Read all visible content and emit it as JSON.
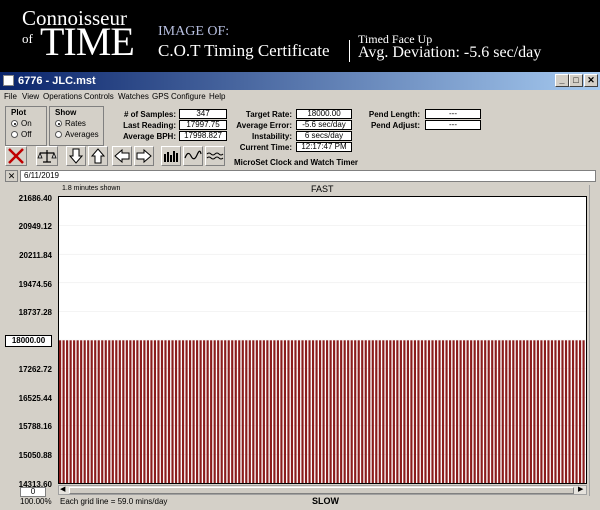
{
  "banner": {
    "brand_top": "Connoisseur",
    "brand_of": "of",
    "brand_time": "TIME",
    "image_of": "IMAGE OF:",
    "certificate": "C.O.T Timing Certificate",
    "timed": "Timed Face Up",
    "avg_deviation": "Avg. Deviation: -5.6 sec/day"
  },
  "window": {
    "title": "6776 - JLC.mst",
    "controls": [
      "_",
      "□",
      "✕"
    ]
  },
  "menu": [
    "File",
    "View",
    "Operations",
    "Controls",
    "Watches",
    "GPS",
    "Configure",
    "Help"
  ],
  "plot_group": {
    "title": "Plot",
    "options": [
      "On",
      "Off"
    ],
    "selected": "On"
  },
  "show_group": {
    "title": "Show",
    "options": [
      "Rates",
      "Averages"
    ],
    "selected": "Rates"
  },
  "stats": {
    "samples_label": "# of Samples:",
    "samples": "347",
    "last_reading_label": "Last Reading:",
    "last_reading": "17997.75",
    "avg_bph_label": "Average BPH:",
    "avg_bph": "17998.827",
    "target_rate_label": "Target Rate:",
    "target_rate": "18000.00",
    "avg_error_label": "Average Error:",
    "avg_error": "-5.6 sec/day",
    "instability_label": "Instability:",
    "instability": "6 secs/day",
    "current_time_label": "Current Time:",
    "current_time": "12:17:47 PM",
    "pend_length_label": "Pend Length:",
    "pend_length": "---",
    "pend_adjust_label": "Pend Adjust:",
    "pend_adjust": "---"
  },
  "microset": "MicroSet Clock and Watch Timer",
  "toolbar_icons": [
    "close-x-icon",
    "balance-scale-icon",
    "arrow-down-icon",
    "arrow-up-icon",
    "arrow-left-icon",
    "arrow-right-icon",
    "bar-graph-icon",
    "wave-graph-icon",
    "flat-wave-icon"
  ],
  "date": "6/11/2019",
  "graph": {
    "minutes_shown": "1.8 minutes shown",
    "top_label": "FAST",
    "bottom_label": "SLOW",
    "zoom": "100.00%",
    "scroll_value": "0",
    "grid_note": "Each grid line = 59.0 mins/day"
  },
  "chart_data": {
    "type": "bar",
    "title": "",
    "xlabel": "",
    "ylabel": "",
    "y_ticks": [
      "21686.40",
      "20949.12",
      "20211.84",
      "19474.56",
      "18737.28",
      "17262.72",
      "16525.44",
      "15788.16",
      "15050.88",
      "14313.60"
    ],
    "target_label": "18000.00",
    "ylim": [
      14313.6,
      21686.4
    ],
    "target": 18000.0,
    "bar_count": 150,
    "bar_value": 17998,
    "bar_color": "#8b1c1c",
    "grid": true
  },
  "colors": {
    "titlebar_start": "#0a246a",
    "titlebar_end": "#a6caf0",
    "bar": "#8b1c1c",
    "window_bg": "#d4d0c8"
  }
}
